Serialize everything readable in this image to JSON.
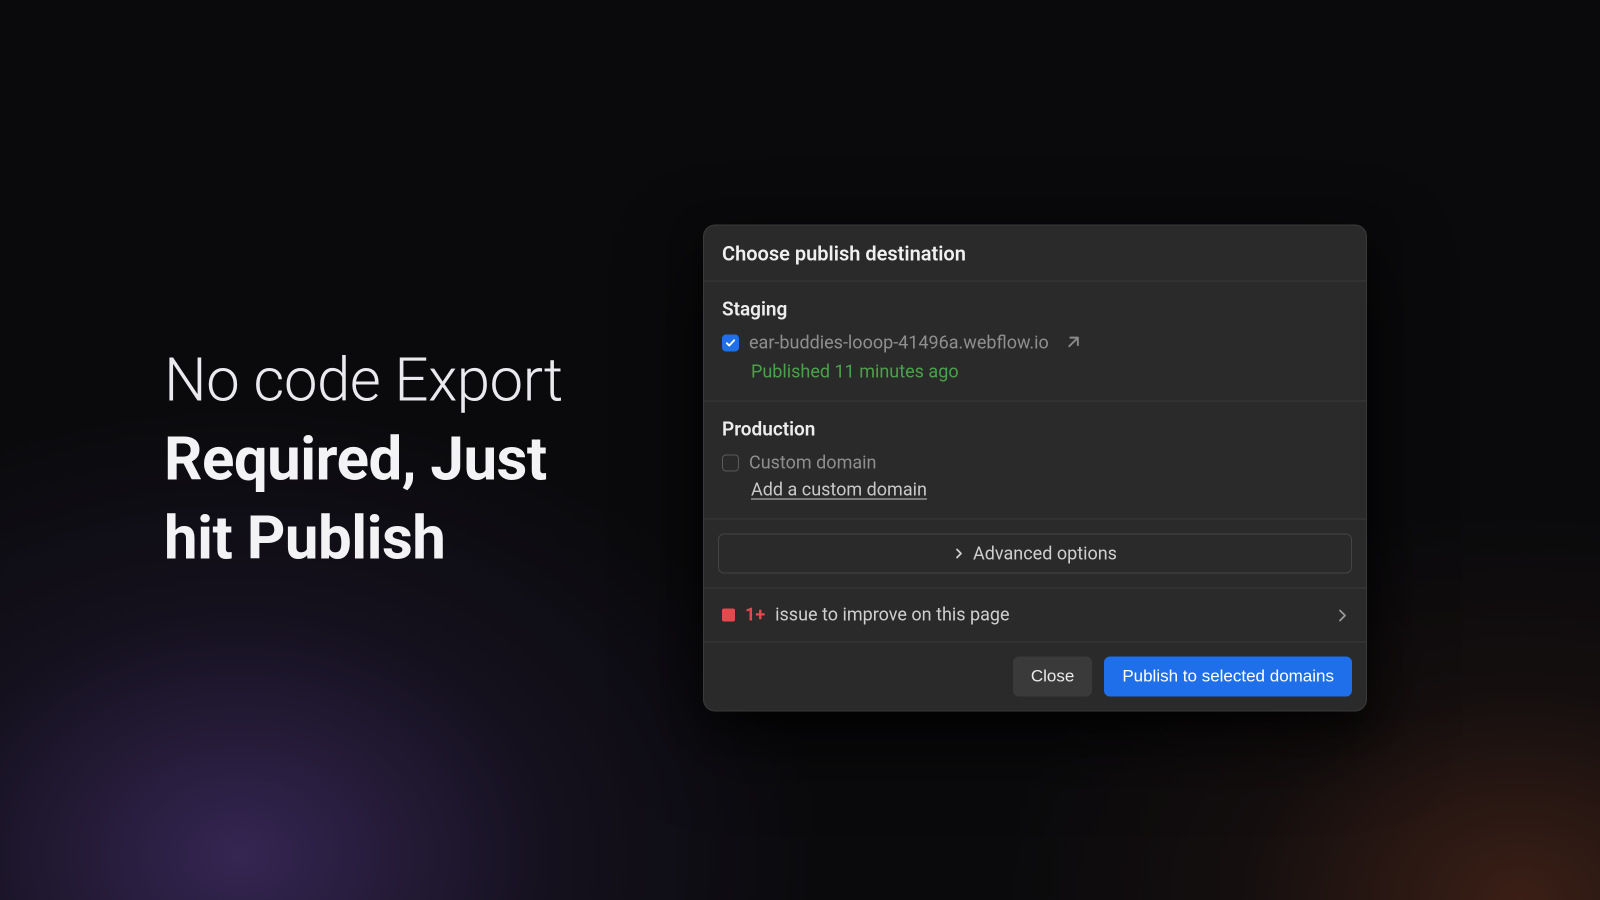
{
  "headline": {
    "line1": "No code Export",
    "line2": "Required, Just",
    "line3": "hit Publish"
  },
  "dialog": {
    "title": "Choose publish destination",
    "staging": {
      "heading": "Staging",
      "domain": "ear-buddies-looop-41496a.webflow.io",
      "checked": true,
      "status": "Published 11 minutes ago"
    },
    "production": {
      "heading": "Production",
      "domain_label": "Custom domain",
      "checked": false,
      "add_link": "Add a custom domain"
    },
    "advanced_label": "Advanced options",
    "issues": {
      "count_label": "1+",
      "text": "issue to improve on this page"
    },
    "footer": {
      "close": "Close",
      "publish": "Publish to selected domains"
    }
  },
  "colors": {
    "accent": "#1f6feb",
    "success": "#4aa24a",
    "danger": "#e5484d"
  }
}
